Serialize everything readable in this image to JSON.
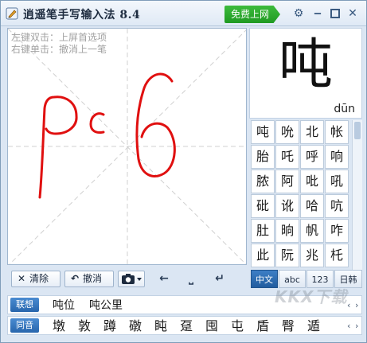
{
  "window": {
    "title": "逍遥笔手写输入法 8.4",
    "promo_label": "免费上网",
    "controls": {
      "settings": "gear-icon",
      "minimize": "minimize-icon",
      "maximize": "maximize-icon",
      "close": "close-icon"
    }
  },
  "pad": {
    "hint_line1": "左键双击：上屏首选项",
    "hint_line2": "右键单击：撤消上一笔",
    "ink_color": "#e01010"
  },
  "toolbar": {
    "clear_label": "清除",
    "undo_label": "撤消",
    "camera": "camera-icon",
    "left_arrow": "←",
    "space": "⎵",
    "enter": "↵"
  },
  "preview": {
    "char": "吨",
    "pinyin": "dūn"
  },
  "candidates": [
    [
      "吨",
      "吮",
      "北",
      "帐"
    ],
    [
      "胎",
      "吒",
      "呼",
      "响"
    ],
    [
      "脓",
      "阿",
      "吡",
      "吼"
    ],
    [
      "砒",
      "讹",
      "哈",
      "吭"
    ],
    [
      "肚",
      "晌",
      "帆",
      "咋"
    ],
    [
      "此",
      "阮",
      "兆",
      "杔"
    ]
  ],
  "modes": {
    "chinese": "中文",
    "abc": "abc",
    "num": "123",
    "jpkr": "日韩"
  },
  "assoc": {
    "tag": "联想",
    "items": [
      "吨位",
      "吨公里"
    ]
  },
  "homophone": {
    "tag": "同音",
    "items": [
      "墩",
      "敦",
      "蹲",
      "礅",
      "盹",
      "趸",
      "囤",
      "屯",
      "盾",
      "臀",
      "遁"
    ]
  },
  "watermark": "KKX下载"
}
